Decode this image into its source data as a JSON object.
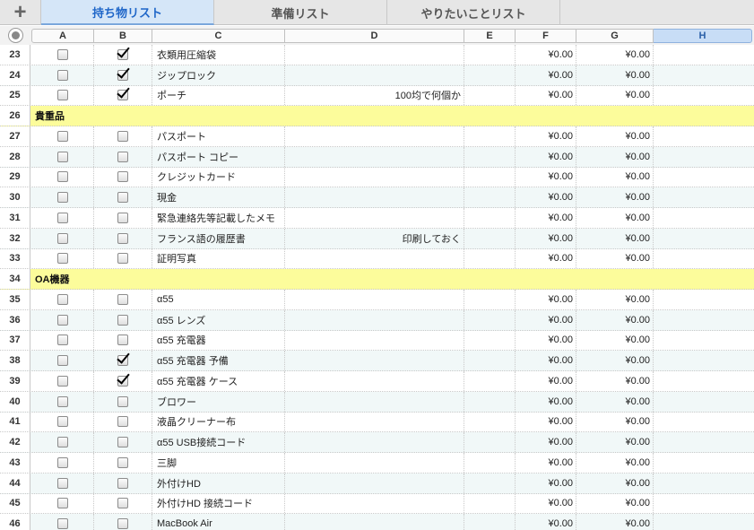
{
  "sheet_tabs": {
    "add_label": "+",
    "tabs": [
      "持ち物リスト",
      "準備リスト",
      "やりたいことリスト"
    ],
    "active_index": 0
  },
  "columns": [
    "A",
    "B",
    "C",
    "D",
    "E",
    "F",
    "G",
    "H"
  ],
  "selected_column": "H",
  "rows": [
    {
      "num": "23",
      "a": false,
      "b": true,
      "name": "衣類用圧縮袋",
      "note": "",
      "f": "¥0.00",
      "g": "¥0.00"
    },
    {
      "num": "24",
      "a": false,
      "b": true,
      "name": "ジップロック",
      "note": "",
      "f": "¥0.00",
      "g": "¥0.00"
    },
    {
      "num": "25",
      "a": false,
      "b": true,
      "name": "ポーチ",
      "note": "100均で何個か",
      "f": "¥0.00",
      "g": "¥0.00"
    },
    {
      "num": "26",
      "section": "貴重品"
    },
    {
      "num": "27",
      "a": false,
      "b": false,
      "name": "パスポート",
      "note": "",
      "f": "¥0.00",
      "g": "¥0.00"
    },
    {
      "num": "28",
      "a": false,
      "b": false,
      "name": "パスポート コピー",
      "note": "",
      "f": "¥0.00",
      "g": "¥0.00"
    },
    {
      "num": "29",
      "a": false,
      "b": false,
      "name": "クレジットカード",
      "note": "",
      "f": "¥0.00",
      "g": "¥0.00"
    },
    {
      "num": "30",
      "a": false,
      "b": false,
      "name": "現金",
      "note": "",
      "f": "¥0.00",
      "g": "¥0.00"
    },
    {
      "num": "31",
      "a": false,
      "b": false,
      "name": "緊急連絡先等記載したメモ",
      "note": "",
      "f": "¥0.00",
      "g": "¥0.00"
    },
    {
      "num": "32",
      "a": false,
      "b": false,
      "name": "フランス語の履歴書",
      "note": "印刷しておく",
      "f": "¥0.00",
      "g": "¥0.00"
    },
    {
      "num": "33",
      "a": false,
      "b": false,
      "name": "証明写真",
      "note": "",
      "f": "¥0.00",
      "g": "¥0.00"
    },
    {
      "num": "34",
      "section": "OA機器"
    },
    {
      "num": "35",
      "a": false,
      "b": false,
      "name": "α55",
      "note": "",
      "f": "¥0.00",
      "g": "¥0.00"
    },
    {
      "num": "36",
      "a": false,
      "b": false,
      "name": "α55 レンズ",
      "note": "",
      "f": "¥0.00",
      "g": "¥0.00"
    },
    {
      "num": "37",
      "a": false,
      "b": false,
      "name": "α55 充電器",
      "note": "",
      "f": "¥0.00",
      "g": "¥0.00"
    },
    {
      "num": "38",
      "a": false,
      "b": true,
      "name": "α55 充電器 予備",
      "note": "",
      "f": "¥0.00",
      "g": "¥0.00"
    },
    {
      "num": "39",
      "a": false,
      "b": true,
      "name": "α55 充電器 ケース",
      "note": "",
      "f": "¥0.00",
      "g": "¥0.00"
    },
    {
      "num": "40",
      "a": false,
      "b": false,
      "name": "ブロワー",
      "note": "",
      "f": "¥0.00",
      "g": "¥0.00"
    },
    {
      "num": "41",
      "a": false,
      "b": false,
      "name": "液晶クリーナー布",
      "note": "",
      "f": "¥0.00",
      "g": "¥0.00"
    },
    {
      "num": "42",
      "a": false,
      "b": false,
      "name": "α55 USB接続コード",
      "note": "",
      "f": "¥0.00",
      "g": "¥0.00"
    },
    {
      "num": "43",
      "a": false,
      "b": false,
      "name": "三脚",
      "note": "",
      "f": "¥0.00",
      "g": "¥0.00"
    },
    {
      "num": "44",
      "a": false,
      "b": false,
      "name": "外付けHD",
      "note": "",
      "f": "¥0.00",
      "g": "¥0.00"
    },
    {
      "num": "45",
      "a": false,
      "b": false,
      "name": "外付けHD 接続コード",
      "note": "",
      "f": "¥0.00",
      "g": "¥0.00"
    },
    {
      "num": "46",
      "a": false,
      "b": false,
      "name": "MacBook Air",
      "note": "",
      "f": "¥0.00",
      "g": "¥0.00"
    }
  ]
}
